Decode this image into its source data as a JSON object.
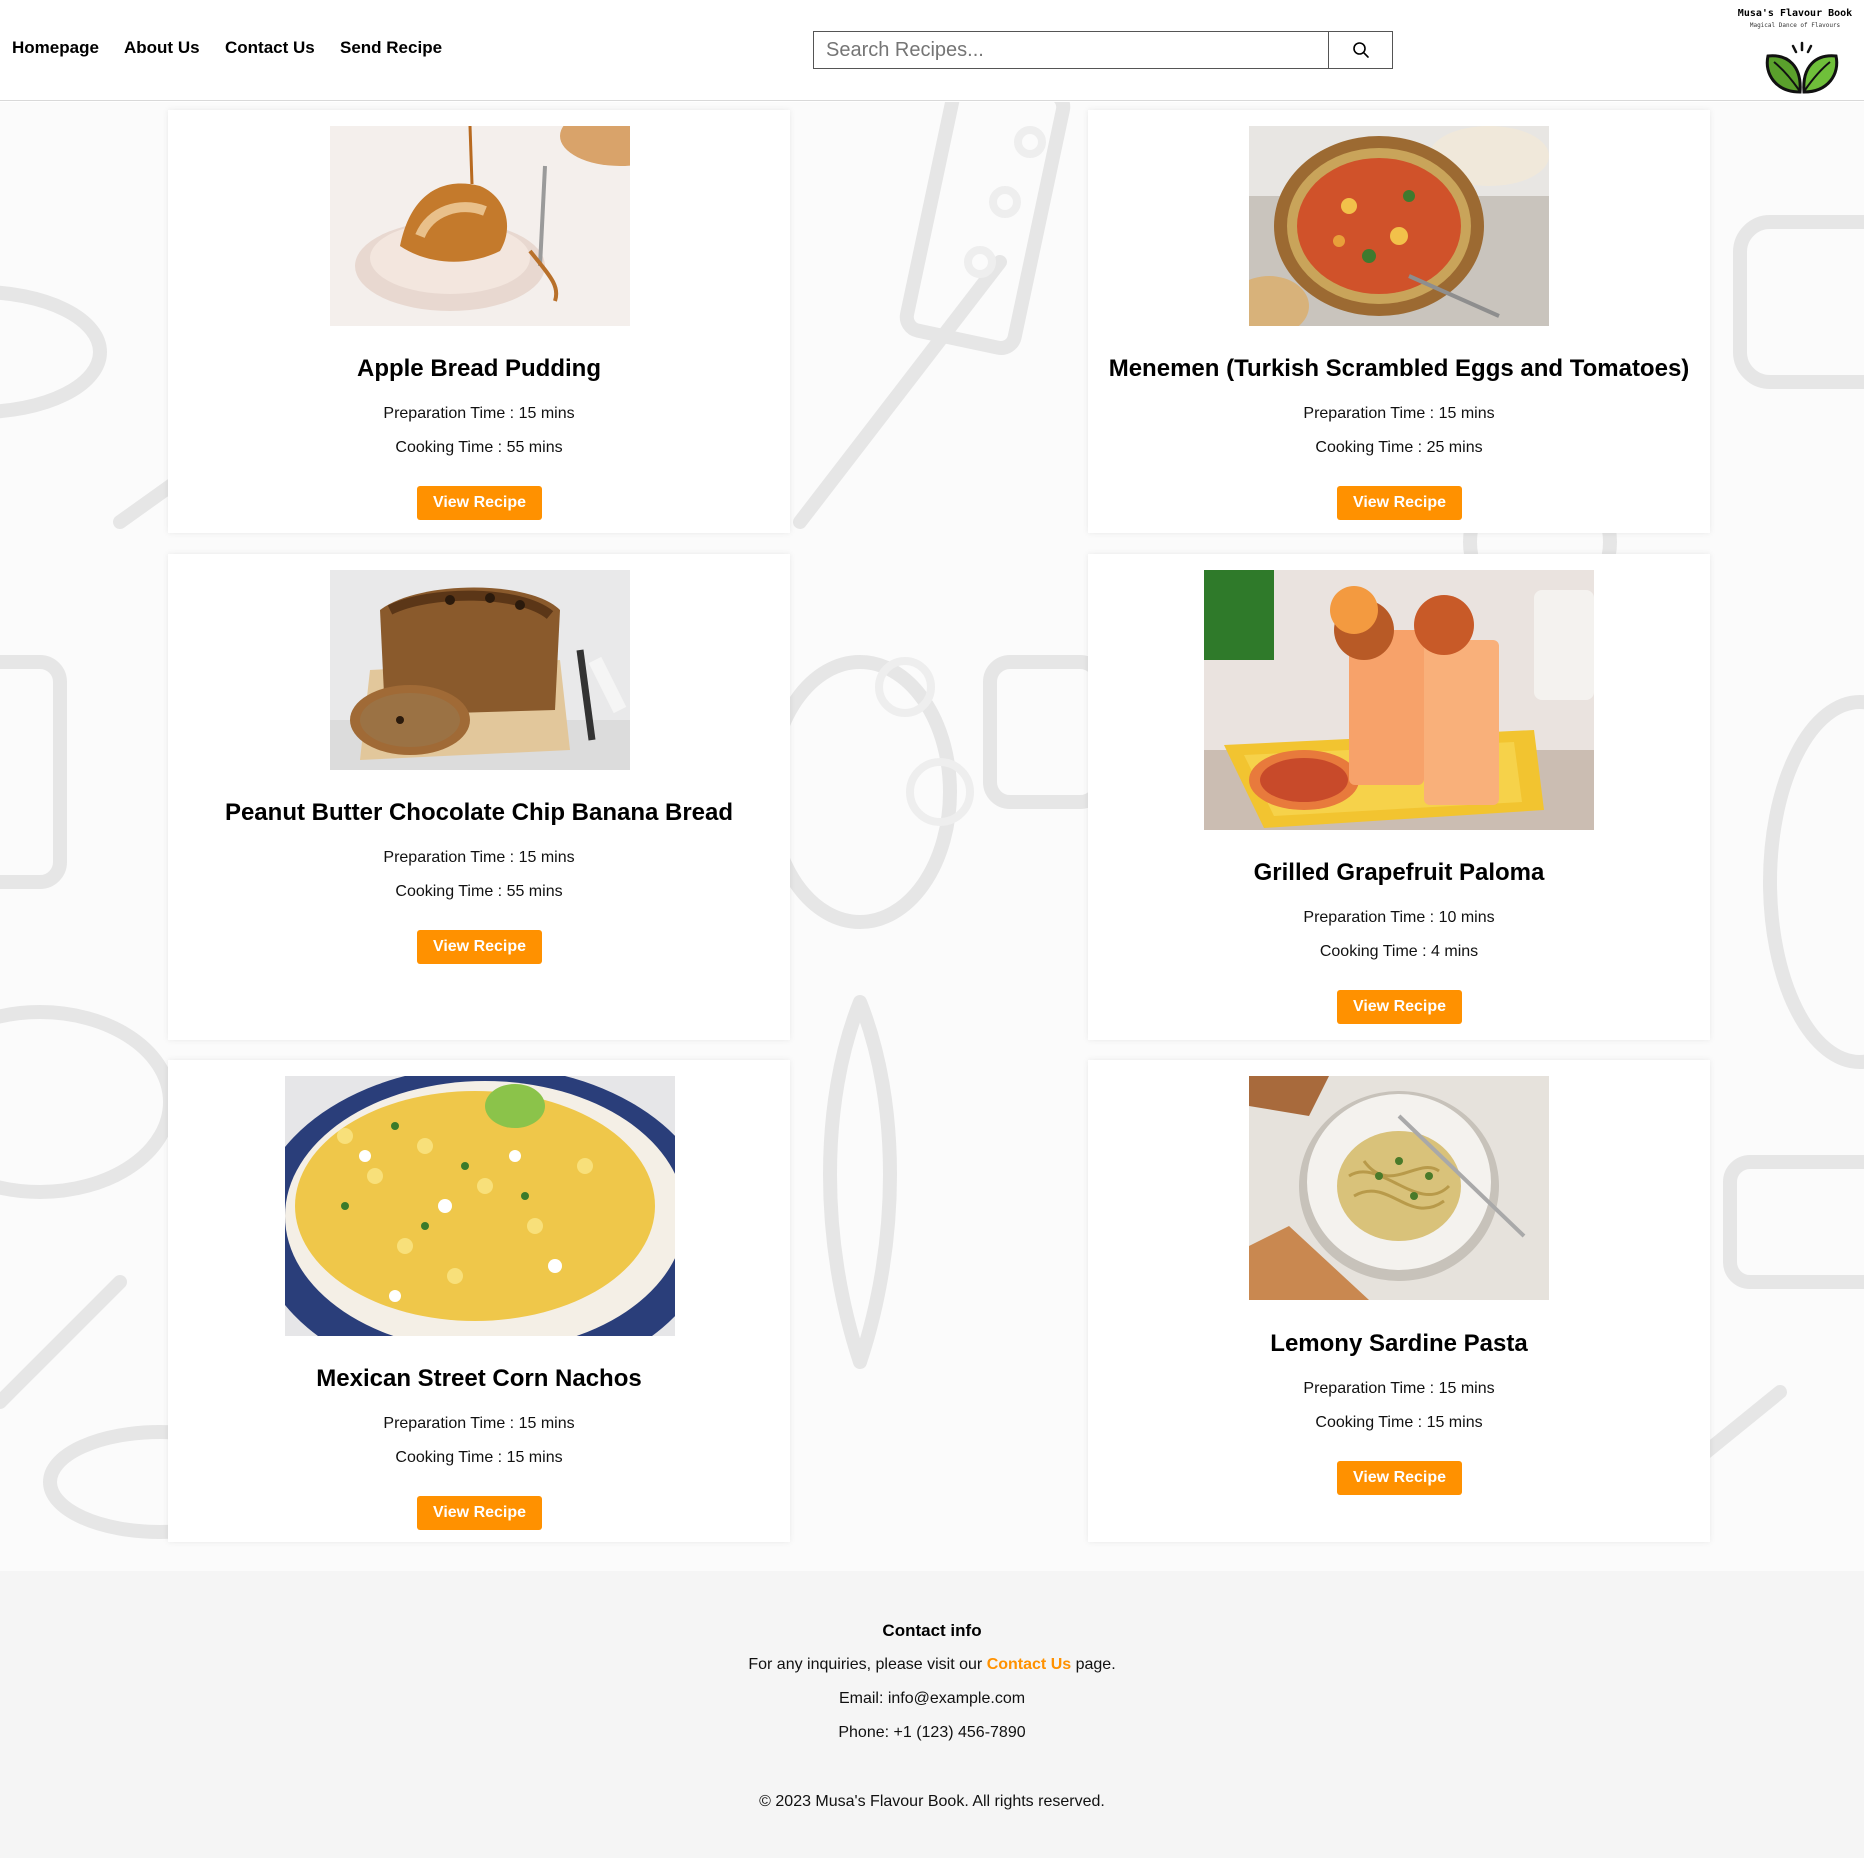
{
  "nav": {
    "items": [
      {
        "label": "Homepage"
      },
      {
        "label": "About Us"
      },
      {
        "label": "Contact Us"
      },
      {
        "label": "Send Recipe"
      }
    ]
  },
  "search": {
    "placeholder": "Search Recipes...",
    "button_icon": "search-icon"
  },
  "logo": {
    "title": "Musa's Flavour Book",
    "tagline": "Magical Dance of Flavours",
    "icon": "leaf-bowl-icon"
  },
  "colors": {
    "accent": "#ff9100",
    "logo_green": "#5aa02c",
    "footer_bg": "#f5f5f5"
  },
  "recipes": [
    {
      "title": "Apple Bread Pudding",
      "prep_label": "Preparation Time",
      "prep_value": "15 mins",
      "cook_label": "Cooking Time",
      "cook_value": "55 mins",
      "button_label": "View Recipe"
    },
    {
      "title": "Menemen (Turkish Scrambled Eggs and Tomatoes)",
      "prep_label": "Preparation Time",
      "prep_value": "15 mins",
      "cook_label": "Cooking Time",
      "cook_value": "25 mins",
      "button_label": "View Recipe"
    },
    {
      "title": "Peanut Butter Chocolate Chip Banana Bread",
      "prep_label": "Preparation Time",
      "prep_value": "15 mins",
      "cook_label": "Cooking Time",
      "cook_value": "55 mins",
      "button_label": "View Recipe"
    },
    {
      "title": "Grilled Grapefruit Paloma",
      "prep_label": "Preparation Time",
      "prep_value": "10 mins",
      "cook_label": "Cooking Time",
      "cook_value": "4 mins",
      "button_label": "View Recipe"
    },
    {
      "title": "Mexican Street Corn Nachos",
      "prep_label": "Preparation Time",
      "prep_value": "15 mins",
      "cook_label": "Cooking Time",
      "cook_value": "15 mins",
      "button_label": "View Recipe"
    },
    {
      "title": "Lemony Sardine Pasta",
      "prep_label": "Preparation Time",
      "prep_value": "15 mins",
      "cook_label": "Cooking Time",
      "cook_value": "15 mins",
      "button_label": "View Recipe"
    }
  ],
  "footer": {
    "heading": "Contact info",
    "inquiry_prefix": "For any inquiries, please visit our",
    "inquiry_link": "Contact Us",
    "inquiry_suffix": "page.",
    "email": "Email: info@example.com",
    "phone": "Phone: +1 (123) 456-7890",
    "copyright": "© 2023 Musa's Flavour Book. All rights reserved."
  }
}
